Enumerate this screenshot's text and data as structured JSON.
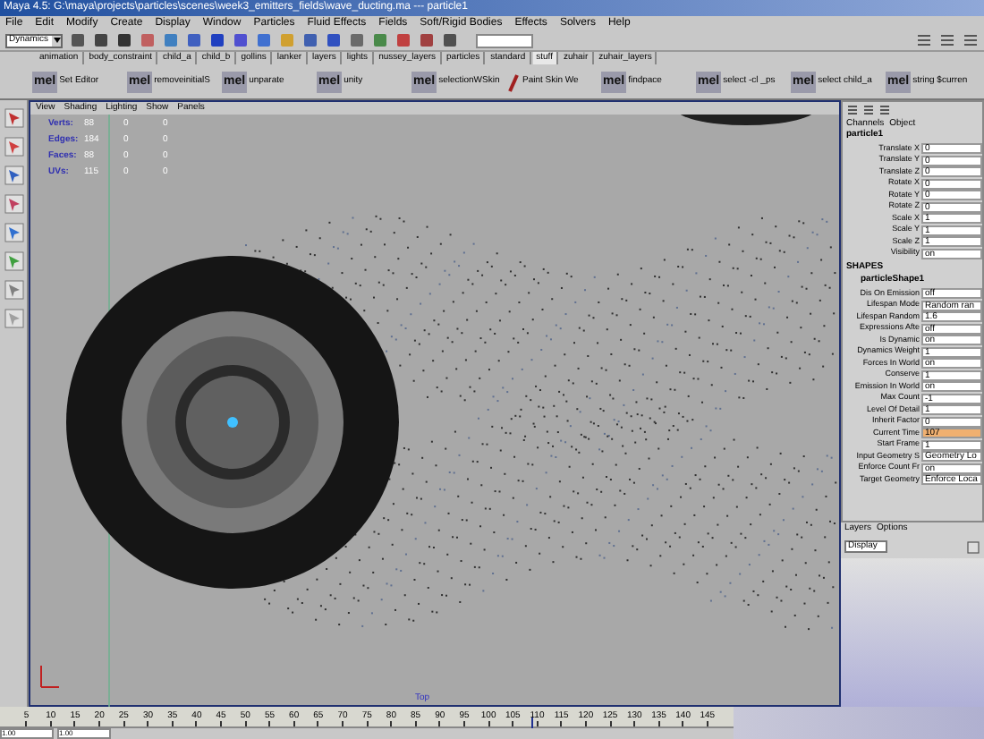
{
  "window": {
    "title": "Maya 4.5: G:\\maya\\projects\\particles\\scenes\\week3_emitters_fields\\wave_ducting.ma  ---  particle1"
  },
  "menu": [
    "File",
    "Edit",
    "Modify",
    "Create",
    "Display",
    "Window",
    "Particles",
    "Fluid Effects",
    "Fields",
    "Soft/Rigid Bodies",
    "Effects",
    "Solvers",
    "Help"
  ],
  "status_line": {
    "mode": "Dynamics"
  },
  "shelf_tabs": [
    {
      "label": "animation",
      "selected": false
    },
    {
      "label": "body_constraint",
      "selected": false
    },
    {
      "label": "child_a",
      "selected": false
    },
    {
      "label": "child_b",
      "selected": false
    },
    {
      "label": "gollins",
      "selected": false
    },
    {
      "label": "lanker",
      "selected": false
    },
    {
      "label": "layers",
      "selected": false
    },
    {
      "label": "lights",
      "selected": false
    },
    {
      "label": "nussey_layers",
      "selected": false
    },
    {
      "label": "particles",
      "selected": false
    },
    {
      "label": "standard",
      "selected": false
    },
    {
      "label": "stuff",
      "selected": true
    },
    {
      "label": "zuhair",
      "selected": false
    },
    {
      "label": "zuhair_layers",
      "selected": false
    }
  ],
  "shelf": [
    {
      "badge": "mel",
      "label": "Set Editor"
    },
    {
      "badge": "mel",
      "label": "removeinitialS"
    },
    {
      "badge": "mel",
      "label": "unparate"
    },
    {
      "badge": "mel",
      "label": "unity"
    },
    {
      "badge": "mel",
      "label": "selectionWSkin"
    },
    {
      "kind": "brush",
      "label": "Paint Skin We"
    },
    {
      "badge": "mel",
      "label": "findpace"
    },
    {
      "badge": "mel",
      "label": "select -cl _ps"
    },
    {
      "badge": "mel",
      "label": "select child_a"
    },
    {
      "badge": "mel",
      "label": "string $curren"
    }
  ],
  "viewport": {
    "menu": [
      "View",
      "Shading",
      "Lighting",
      "Show",
      "Panels"
    ],
    "hud": [
      {
        "label": "Verts:",
        "values": [
          "88",
          "0",
          "0"
        ]
      },
      {
        "label": "Edges:",
        "values": [
          "184",
          "0",
          "0"
        ]
      },
      {
        "label": "Faces:",
        "values": [
          "88",
          "0",
          "0"
        ]
      },
      {
        "label": "UVs:",
        "values": [
          "115",
          "0",
          "0"
        ]
      }
    ],
    "camera": "Top"
  },
  "channel_box": {
    "menu": [
      "Channels",
      "Object"
    ],
    "node": "particle1",
    "attributes": [
      {
        "name": "Translate X",
        "value": "0",
        "highlighted": false
      },
      {
        "name": "Translate Y",
        "value": "0",
        "highlighted": false
      },
      {
        "name": "Translate Z",
        "value": "0",
        "highlighted": false
      },
      {
        "name": "Rotate X",
        "value": "0",
        "highlighted": false
      },
      {
        "name": "Rotate Y",
        "value": "0",
        "highlighted": false
      },
      {
        "name": "Rotate Z",
        "value": "0",
        "highlighted": false
      },
      {
        "name": "Scale X",
        "value": "1",
        "highlighted": false
      },
      {
        "name": "Scale Y",
        "value": "1",
        "highlighted": false
      },
      {
        "name": "Scale Z",
        "value": "1",
        "highlighted": false
      },
      {
        "name": "Visibility",
        "value": "on",
        "highlighted": false
      }
    ],
    "shapes_heading": "SHAPES",
    "shape": "particleShape1",
    "shape_attributes": [
      {
        "name": "Dis On Emission",
        "value": "off",
        "highlighted": false
      },
      {
        "name": "Lifespan Mode",
        "value": "Random ran",
        "highlighted": false
      },
      {
        "name": "Lifespan Random",
        "value": "1.6",
        "highlighted": false
      },
      {
        "name": "Expressions Afte",
        "value": "off",
        "highlighted": false
      },
      {
        "name": "Is Dynamic",
        "value": "on",
        "highlighted": false
      },
      {
        "name": "Dynamics Weight",
        "value": "1",
        "highlighted": false
      },
      {
        "name": "Forces In World",
        "value": "on",
        "highlighted": false
      },
      {
        "name": "Conserve",
        "value": "1",
        "highlighted": false
      },
      {
        "name": "Emission In World",
        "value": "on",
        "highlighted": false
      },
      {
        "name": "Max Count",
        "value": "-1",
        "highlighted": false
      },
      {
        "name": "Level Of Detail",
        "value": "1",
        "highlighted": false
      },
      {
        "name": "Inherit Factor",
        "value": "0",
        "highlighted": false
      },
      {
        "name": "Current Time",
        "value": "107",
        "highlighted": true
      },
      {
        "name": "Start Frame",
        "value": "1",
        "highlighted": false
      },
      {
        "name": "Input Geometry S",
        "value": "Geometry Lo",
        "highlighted": false
      },
      {
        "name": "Enforce Count Fr",
        "value": "on",
        "highlighted": false
      },
      {
        "name": "Target Geometry",
        "value": "Enforce Loca",
        "highlighted": false
      }
    ]
  },
  "layers": {
    "menu": [
      "Layers",
      "Options"
    ],
    "mode": "Display"
  },
  "timeline": {
    "level": 0.725,
    "ticks": [
      "5",
      "10",
      "15",
      "20",
      "25",
      "30",
      "35",
      "40",
      "45",
      "50",
      "55",
      "60",
      "65",
      "70",
      "75",
      "80",
      "85",
      "90",
      "95",
      "100",
      "105",
      "110",
      "115",
      "120",
      "125",
      "130",
      "135",
      "140",
      "145"
    ],
    "range_start": "1.00",
    "range_end": "1.00"
  }
}
